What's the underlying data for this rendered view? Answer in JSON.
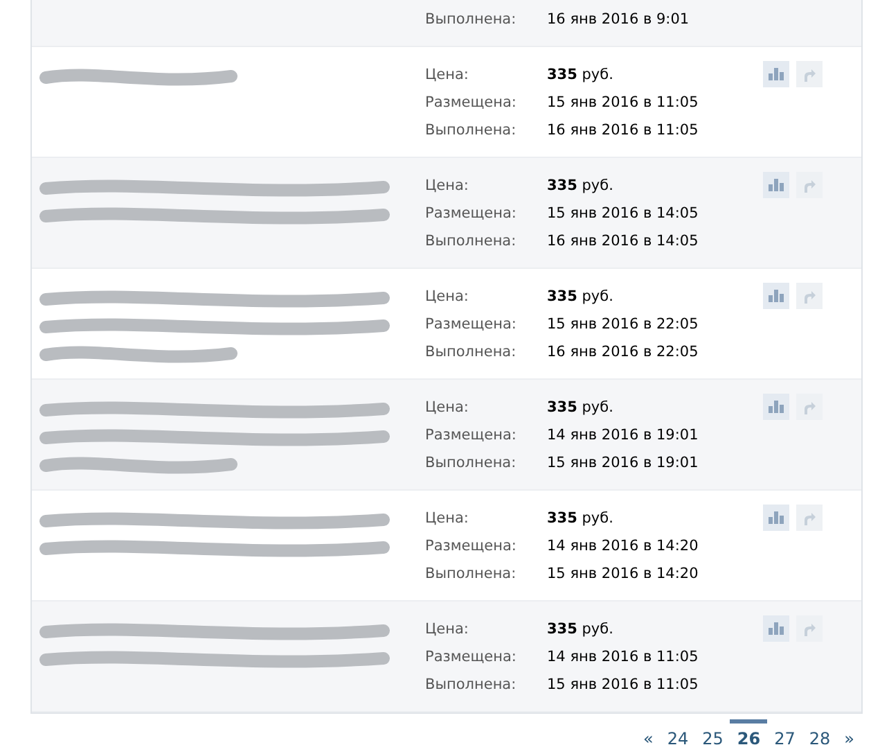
{
  "orders": [
    {
      "fields": [
        {
          "label": "Выполнена:",
          "value": "16 янв 2016 в 9:01"
        }
      ]
    },
    {
      "note": {
        "kind": "scribble",
        "lines": [
          {
            "kind": "short"
          }
        ]
      },
      "fields": [
        {
          "label": "Цена:",
          "value": "**335** руб."
        },
        {
          "label": "Размещена:",
          "value": "15 янв 2016 в 11:05"
        },
        {
          "label": "Выполнена:",
          "value": "16 янв 2016 в 11:05"
        }
      ],
      "actions": [
        {
          "kind": "stats",
          "disabled": false
        },
        {
          "kind": "share",
          "disabled": true
        }
      ]
    },
    {
      "note": {
        "kind": "scribble",
        "lines": [
          {
            "kind": "long"
          },
          {
            "kind": "long"
          }
        ]
      },
      "fields": [
        {
          "label": "Цена:",
          "value": "**335** руб."
        },
        {
          "label": "Размещена:",
          "value": "15 янв 2016 в 14:05"
        },
        {
          "label": "Выполнена:",
          "value": "16 янв 2016 в 14:05"
        }
      ],
      "actions": [
        {
          "kind": "stats",
          "disabled": false
        },
        {
          "kind": "share",
          "disabled": true
        }
      ]
    },
    {
      "note": {
        "kind": "scribble",
        "lines": [
          {
            "kind": "long"
          },
          {
            "kind": "long"
          },
          {
            "kind": "short"
          }
        ]
      },
      "fields": [
        {
          "label": "Цена:",
          "value": "**335** руб."
        },
        {
          "label": "Размещена:",
          "value": "15 янв 2016 в 22:05"
        },
        {
          "label": "Выполнена:",
          "value": "16 янв 2016 в 22:05"
        }
      ],
      "actions": [
        {
          "kind": "stats",
          "disabled": false
        },
        {
          "kind": "share",
          "disabled": true
        }
      ]
    },
    {
      "note": {
        "kind": "scribble",
        "lines": [
          {
            "kind": "long"
          },
          {
            "kind": "long"
          },
          {
            "kind": "short"
          }
        ]
      },
      "fields": [
        {
          "label": "Цена:",
          "value": "**335** руб."
        },
        {
          "label": "Размещена:",
          "value": "14 янв 2016 в 19:01"
        },
        {
          "label": "Выполнена:",
          "value": "15 янв 2016 в 19:01"
        }
      ],
      "actions": [
        {
          "kind": "stats",
          "disabled": false
        },
        {
          "kind": "share",
          "disabled": true
        }
      ]
    },
    {
      "note": {
        "kind": "scribble",
        "lines": [
          {
            "kind": "long"
          },
          {
            "kind": "long"
          }
        ]
      },
      "fields": [
        {
          "label": "Цена:",
          "value": "**335** руб."
        },
        {
          "label": "Размещена:",
          "value": "14 янв 2016 в 14:20"
        },
        {
          "label": "Выполнена:",
          "value": "15 янв 2016 в 14:20"
        }
      ],
      "actions": [
        {
          "kind": "stats",
          "disabled": false
        },
        {
          "kind": "share",
          "disabled": true
        }
      ]
    },
    {
      "note": {
        "kind": "scribble",
        "lines": [
          {
            "kind": "long"
          },
          {
            "kind": "long"
          }
        ]
      },
      "fields": [
        {
          "label": "Цена:",
          "value": "**335** руб."
        },
        {
          "label": "Размещена:",
          "value": "14 янв 2016 в 11:05"
        },
        {
          "label": "Выполнена:",
          "value": "15 янв 2016 в 11:05"
        }
      ],
      "actions": [
        {
          "kind": "stats",
          "disabled": false
        },
        {
          "kind": "share",
          "disabled": true
        }
      ]
    }
  ],
  "pagination": [
    {
      "label": "«",
      "selected": false
    },
    {
      "label": "24",
      "selected": false
    },
    {
      "label": "25",
      "selected": false
    },
    {
      "label": "26",
      "selected": true
    },
    {
      "label": "27",
      "selected": false
    },
    {
      "label": "28",
      "selected": false
    },
    {
      "label": "»",
      "selected": false
    }
  ]
}
